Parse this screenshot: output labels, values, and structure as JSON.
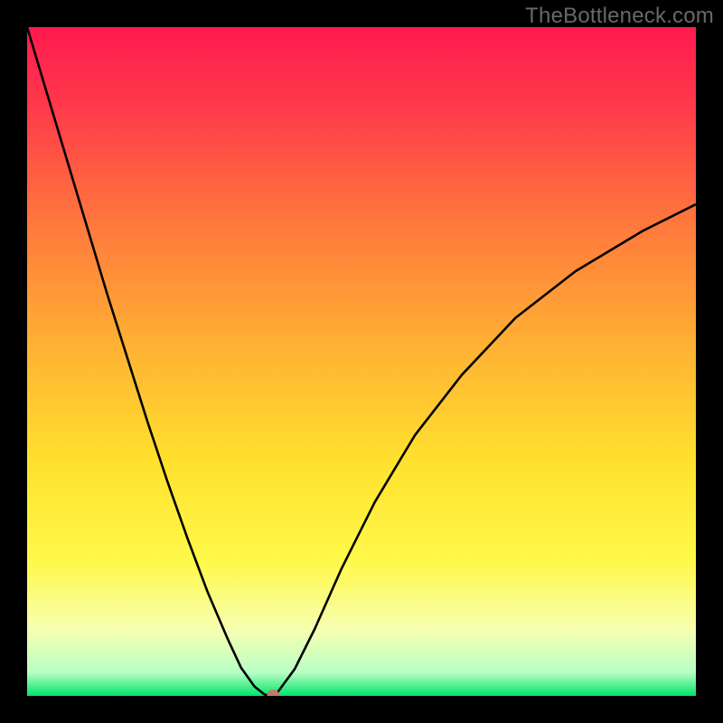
{
  "watermark": "TheBottleneck.com",
  "chart_data": {
    "type": "line",
    "title": "",
    "xlabel": "",
    "ylabel": "",
    "xlim": [
      0,
      100
    ],
    "ylim": [
      0,
      100
    ],
    "grid": false,
    "background_gradient": {
      "description": "vertical gradient, plot area only, black border",
      "stops": [
        {
          "pos": 0.0,
          "color": "#ff1a4f"
        },
        {
          "pos": 0.12,
          "color": "#ff3a4a"
        },
        {
          "pos": 0.3,
          "color": "#ff7a3c"
        },
        {
          "pos": 0.48,
          "color": "#ffb233"
        },
        {
          "pos": 0.65,
          "color": "#ffe12e"
        },
        {
          "pos": 0.8,
          "color": "#fff94a"
        },
        {
          "pos": 0.9,
          "color": "#f7ffb0"
        },
        {
          "pos": 0.965,
          "color": "#b8ffc4"
        },
        {
          "pos": 1.0,
          "color": "#00e46a"
        }
      ]
    },
    "series": [
      {
        "name": "curve",
        "color": "#000000",
        "width": 2.6,
        "x": [
          0,
          3,
          6,
          9,
          12,
          15,
          18,
          21,
          24,
          27,
          30,
          32,
          34,
          35.5,
          36.5,
          37.5,
          40,
          43,
          47,
          52,
          58,
          65,
          73,
          82,
          92,
          100
        ],
        "y": [
          100,
          90,
          80,
          70,
          60,
          50.5,
          41,
          32,
          23.5,
          15.5,
          8.5,
          4.2,
          1.4,
          0.2,
          0.0,
          0.6,
          4.0,
          10,
          19,
          29,
          39,
          48,
          56.5,
          63.5,
          69.5,
          73.5
        ]
      }
    ],
    "marker": {
      "description": "small pink/brown dot at curve minimum",
      "x": 36.8,
      "y": 0.0,
      "radius_px": 7,
      "fill": "#c37a6e"
    }
  }
}
